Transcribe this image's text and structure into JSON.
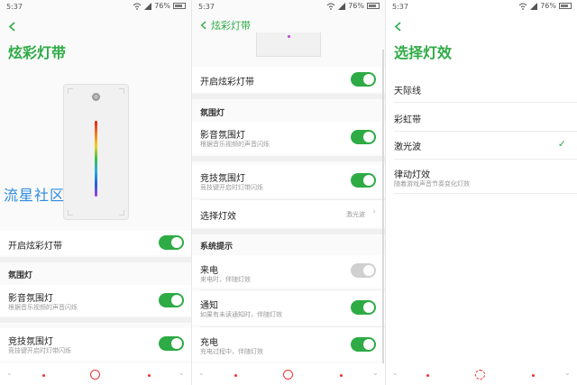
{
  "status": {
    "time": "5:37",
    "battery": "76%"
  },
  "panel1": {
    "title": "炫彩灯带",
    "watermark": "流星社区",
    "master_toggle_label": "开启炫彩灯带",
    "section_ambient": "氛围灯",
    "video_light": {
      "label": "影音氛围灯",
      "sub": "根据音乐视频的声音闪烁"
    },
    "game_light": {
      "label": "竞技氛围灯",
      "sub": "竞技键开启时灯带闪烁"
    }
  },
  "panel2": {
    "header": "炫彩灯带",
    "master_toggle_label": "开启炫彩灯带",
    "section_ambient": "氛围灯",
    "video_light": {
      "label": "影音氛围灯",
      "sub": "根据音乐视频的声音闪烁"
    },
    "game_light": {
      "label": "竞技氛围灯",
      "sub": "竞技键开启时灯带闪烁"
    },
    "effect_row": {
      "label": "选择灯效",
      "value": "激光波"
    },
    "section_system": "系统提示",
    "incoming": {
      "label": "来电",
      "sub": "来电时，伴随灯效"
    },
    "notify": {
      "label": "通知",
      "sub": "如果有未读通知时，伴随灯效"
    },
    "charging": {
      "label": "充电",
      "sub": "充电过程中，伴随灯效"
    }
  },
  "panel3": {
    "title": "选择灯效",
    "effects": [
      {
        "label": "天际线"
      },
      {
        "label": "彩虹带"
      },
      {
        "label": "激光波",
        "selected": true
      },
      {
        "label": "律动灯效",
        "sub": "随着游戏声音节奏变化灯效"
      }
    ]
  },
  "colors": {
    "accent": "#2eab45",
    "nav": "#e33333"
  }
}
